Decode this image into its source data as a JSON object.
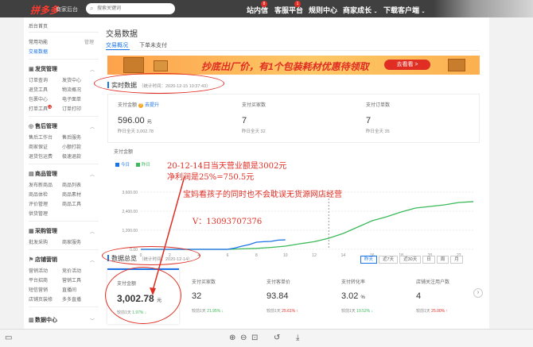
{
  "topbar": {
    "logo": "拼多多",
    "logo_sub": "商家后台",
    "search_placeholder": "搜索关键词",
    "nav": [
      {
        "label": "站内信",
        "badge": "8"
      },
      {
        "label": "客服平台",
        "badge": "1"
      },
      {
        "label": "规则中心"
      },
      {
        "label": "商家成长",
        "caret": "⌄"
      },
      {
        "label": "下载客户端",
        "caret": "⌄"
      }
    ]
  },
  "sidebar": {
    "home": "后台首页",
    "common": "常用功能",
    "manage": "管理",
    "trade_data": "交易数据",
    "sections": [
      {
        "title": "发货管理",
        "icon": "truck-icon",
        "items": [
          "订单查询",
          "发货中心",
          "退货工具",
          "物流概况",
          "包裹中心",
          "电子面单",
          "打单工具",
          "订单打印"
        ],
        "badge": "11"
      },
      {
        "title": "售后管理",
        "icon": "service-icon",
        "items": [
          "售后工作台",
          "售后服务",
          "商家保证",
          "小额打款",
          "退货包运费",
          "极速退款"
        ]
      },
      {
        "title": "商品管理",
        "icon": "box-icon",
        "items": [
          "发布新商品",
          "商品列表",
          "商品体检",
          "商品素材",
          "评价管理",
          "商品工具",
          "供货管理"
        ]
      },
      {
        "title": "采购管理",
        "icon": "cart-icon",
        "items": [
          "批发采购",
          "商家服务"
        ]
      },
      {
        "title": "店铺营销",
        "icon": "flag-icon",
        "items": [
          "营销活动",
          "竞价活动",
          "平台招商",
          "营销工具",
          "短信营销",
          "直播间",
          "店铺页装修",
          "多多直播"
        ]
      },
      {
        "title": "数据中心",
        "icon": "chart-icon",
        "items": []
      }
    ]
  },
  "main": {
    "title": "交易数据",
    "tabs": [
      "交易概况",
      "下单未支付"
    ],
    "banner": {
      "text": "抄底出厂价，有1个包装耗材优惠待领取",
      "button": "去看看 >"
    },
    "realtime": {
      "title": "实时数据",
      "note": "（统计时间：2020-12-15 10:37:43）",
      "metrics": [
        {
          "label": "支付金额",
          "link": "去提升",
          "value": "596.00",
          "unit": "元",
          "sub": "昨日全天",
          "sub_val": "3,002.78"
        },
        {
          "label": "支付买家数",
          "value": "7",
          "sub": "昨日全天",
          "sub_val": "32"
        },
        {
          "label": "支付订单数",
          "value": "7",
          "sub": "昨日全天",
          "sub_val": "35"
        }
      ]
    },
    "chart_title": "支付金额",
    "legend": {
      "today": "今日",
      "yesterday": "昨日"
    },
    "overview": {
      "title": "数据总览",
      "note": "（统计时间：2020-12-14）",
      "ranges": [
        "昨天",
        "近7天",
        "近30天",
        "日",
        "周",
        "月"
      ],
      "cards": [
        {
          "label": "支付金额",
          "value": "3,002.78",
          "unit": "元",
          "cmp": "较前1天",
          "pct": "1.97%",
          "dir": "↓",
          "color": "g"
        },
        {
          "label": "支付买家数",
          "value": "32",
          "cmp": "较前1天",
          "pct": "21.95%",
          "dir": "↓",
          "color": "g"
        },
        {
          "label": "支付客单价",
          "value": "93.84",
          "cmp": "较前1天",
          "pct": "25.61%",
          "dir": "↑",
          "color": "r"
        },
        {
          "label": "支付转化率",
          "value": "3.02",
          "unit": "%",
          "cmp": "较前1天",
          "pct": "19.52%",
          "dir": "↓",
          "color": "g"
        },
        {
          "label": "店铺关注用户数",
          "value": "4",
          "cmp": "较前1天",
          "pct": "25.00%",
          "dir": "↑",
          "color": "r"
        }
      ]
    },
    "annotations": {
      "line1": "20-12-14日当天营业额是3002元",
      "line2": "净利润是25%=750.5元",
      "line3": "宝妈看孩子的同时也不会耽误无货源网店经营",
      "line4": "V：13093707376"
    }
  },
  "chart_data": {
    "type": "line",
    "yticks": [
      "3,600.00",
      "2,400.00",
      "1,200.00",
      "0.00"
    ],
    "xticks": [
      "0",
      "2",
      "4",
      "6",
      "8",
      "10",
      "12",
      "14",
      "16",
      "18",
      "20",
      "22"
    ],
    "ylim": [
      0,
      3600
    ],
    "xlim": [
      0,
      23
    ],
    "series": [
      {
        "name": "今日",
        "color": "#1a73e8",
        "x": [
          0,
          1,
          2,
          3,
          4,
          5,
          6,
          6.5,
          7,
          7.5,
          8,
          8.5,
          9,
          9.5,
          10
        ],
        "y": [
          0,
          0,
          0,
          0,
          0,
          0,
          0,
          80,
          200,
          300,
          450,
          480,
          500,
          580,
          596
        ]
      },
      {
        "name": "昨日",
        "color": "#3cb95b",
        "x": [
          0,
          1,
          2,
          3,
          4,
          5,
          6,
          7,
          8,
          9,
          10,
          11,
          12,
          13,
          14,
          15,
          16,
          17,
          18,
          19,
          20,
          21,
          22,
          23
        ],
        "y": [
          0,
          0,
          0,
          0,
          0,
          0,
          0,
          30,
          60,
          120,
          200,
          350,
          480,
          700,
          1000,
          1400,
          1800,
          2050,
          2350,
          2600,
          2700,
          2800,
          2950,
          3002
        ]
      }
    ]
  },
  "colors": {
    "accent": "#1a73e8",
    "brand": "#e02e24",
    "up": "#e02e24",
    "down": "#3cb95b"
  },
  "bottom_icons": [
    "sidebar-toggle-icon",
    "zoom-in-icon",
    "zoom-out-icon",
    "fit-icon",
    "undo-icon",
    "download-icon"
  ]
}
